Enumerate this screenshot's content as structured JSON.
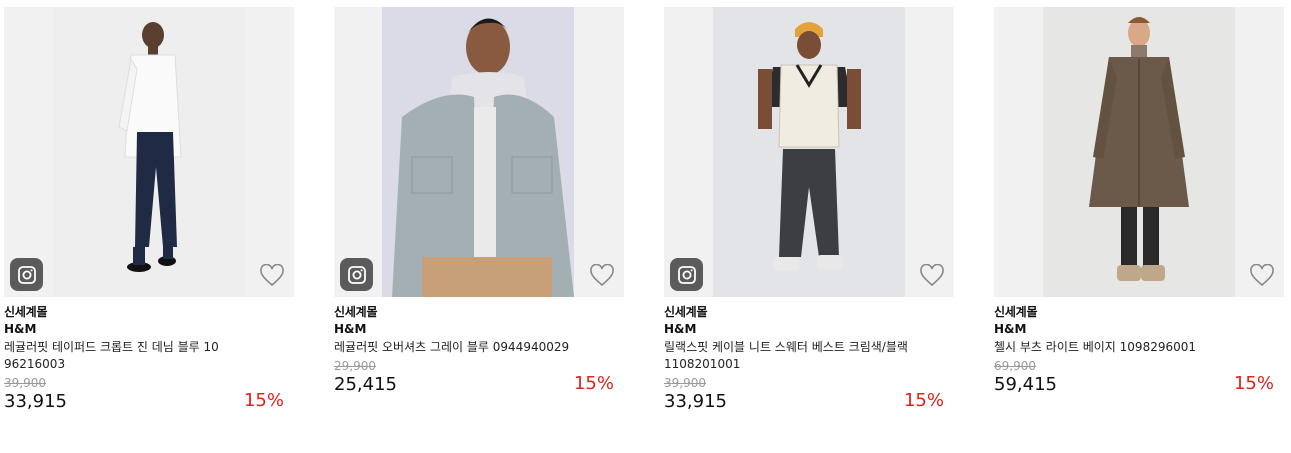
{
  "products": [
    {
      "mall": "신세계몰",
      "brand": "H&M",
      "name": "레귤러핏 테이퍼드 크롭트 진 데님 블루 1096216003",
      "original_price": "39,900",
      "price": "33,915",
      "discount": "15%",
      "has_instagram": true
    },
    {
      "mall": "신세계몰",
      "brand": "H&M",
      "name": "레귤러핏 오버셔츠 그레이 블루 0944940029",
      "original_price": "29,900",
      "price": "25,415",
      "discount": "15%",
      "has_instagram": true
    },
    {
      "mall": "신세계몰",
      "brand": "H&M",
      "name": "릴랙스핏 케이블 니트 스웨터 베스트 크림색/블랙 1108201001",
      "original_price": "39,900",
      "price": "33,915",
      "discount": "15%",
      "has_instagram": true
    },
    {
      "mall": "신세계몰",
      "brand": "H&M",
      "name": "첼시 부츠 라이트 베이지 1098296001",
      "original_price": "69,900",
      "price": "59,415",
      "discount": "15%",
      "has_instagram": false
    }
  ],
  "colors": {
    "discount": "#e2231a",
    "original_price": "#9a9a9a",
    "image_bg": "#f1f1f1",
    "instagram_badge": "#5b5b5b"
  },
  "icons": {
    "instagram": "instagram-icon",
    "wishlist": "heart-outline-icon"
  }
}
